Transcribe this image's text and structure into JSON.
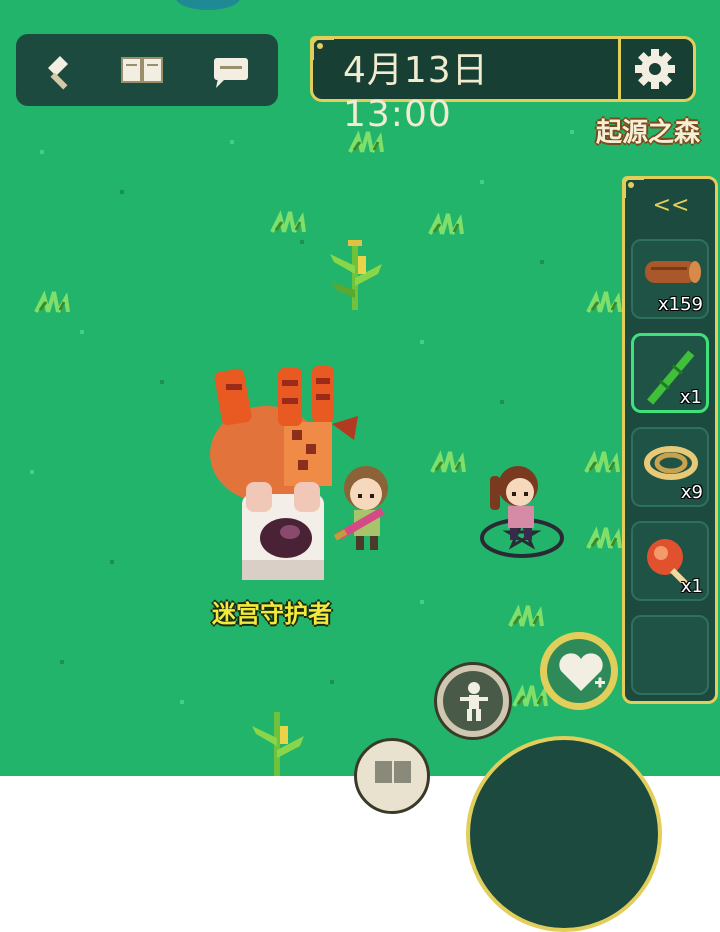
{
  "hud": {
    "date": "4月13日",
    "time": "13:00",
    "location": "起源之森"
  },
  "toolbar": {
    "items": [
      {
        "icon": "hammer-icon"
      },
      {
        "icon": "book-icon"
      },
      {
        "icon": "chat-icon"
      }
    ]
  },
  "inventory": {
    "collapse_label": "<<",
    "slots": [
      {
        "item": "wood-log-icon",
        "qty": "x159"
      },
      {
        "item": "bamboo-stick-icon",
        "qty": "x1",
        "selected": true
      },
      {
        "item": "rope-icon",
        "qty": "x9"
      },
      {
        "item": "meat-skewer-icon",
        "qty": "x1"
      },
      {
        "item": "",
        "qty": ""
      }
    ]
  },
  "npc": {
    "name": "迷宫守护者"
  },
  "colors": {
    "grass": "#22b46a",
    "panel": "#1c4a3e",
    "gold_border": "#e2cf5b",
    "npc_label": "#f2ea3c"
  }
}
